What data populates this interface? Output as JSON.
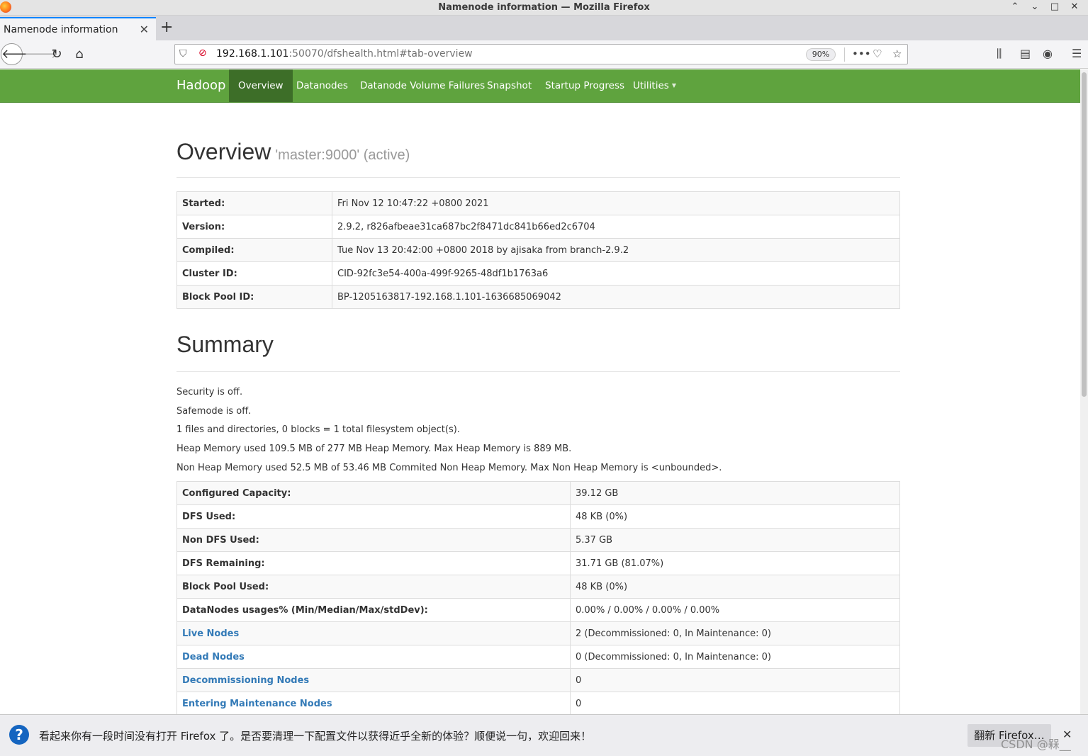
{
  "window": {
    "title": "Namenode information — Mozilla Firefox",
    "controls": [
      "⌃",
      "⌄",
      "□",
      "✕"
    ]
  },
  "tab": {
    "title": "Namenode information",
    "close": "✕",
    "new": "+"
  },
  "toolbar": {
    "url_host": "192.168.1.101",
    "url_rest": ":50070/dfshealth.html#tab-overview",
    "zoom": "90%"
  },
  "hadoop_nav": {
    "brand": "Hadoop",
    "items": [
      "Overview",
      "Datanodes",
      "Datanode Volume Failures",
      "Snapshot",
      "Startup Progress",
      "Utilities"
    ],
    "active": "Overview"
  },
  "overview": {
    "heading": "Overview",
    "subheading": "'master:9000' (active)",
    "rows": [
      {
        "k": "Started:",
        "v": "Fri Nov 12 10:47:22 +0800 2021"
      },
      {
        "k": "Version:",
        "v": "2.9.2, r826afbeae31ca687bc2f8471dc841b66ed2c6704"
      },
      {
        "k": "Compiled:",
        "v": "Tue Nov 13 20:42:00 +0800 2018 by ajisaka from branch-2.9.2"
      },
      {
        "k": "Cluster ID:",
        "v": "CID-92fc3e54-400a-499f-9265-48df1b1763a6"
      },
      {
        "k": "Block Pool ID:",
        "v": "BP-1205163817-192.168.1.101-1636685069042"
      }
    ]
  },
  "summary": {
    "heading": "Summary",
    "lines": [
      "Security is off.",
      "Safemode is off.",
      "1 files and directories, 0 blocks = 1 total filesystem object(s).",
      "Heap Memory used 109.5 MB of 277 MB Heap Memory. Max Heap Memory is 889 MB.",
      "Non Heap Memory used 52.5 MB of 53.46 MB Commited Non Heap Memory. Max Non Heap Memory is <unbounded>."
    ],
    "rows": [
      {
        "k": "Configured Capacity:",
        "v": "39.12 GB"
      },
      {
        "k": "DFS Used:",
        "v": "48 KB (0%)"
      },
      {
        "k": "Non DFS Used:",
        "v": "5.37 GB"
      },
      {
        "k": "DFS Remaining:",
        "v": "31.71 GB (81.07%)"
      },
      {
        "k": "Block Pool Used:",
        "v": "48 KB (0%)"
      },
      {
        "k": "DataNodes usages% (Min/Median/Max/stdDev):",
        "v": "0.00% / 0.00% / 0.00% / 0.00%"
      },
      {
        "k": "Live Nodes",
        "v": "2 (Decommissioned: 0, In Maintenance: 0)",
        "link": true
      },
      {
        "k": "Dead Nodes",
        "v": "0 (Decommissioned: 0, In Maintenance: 0)",
        "link": true
      },
      {
        "k": "Decommissioning Nodes",
        "v": "0",
        "link": true
      },
      {
        "k": "Entering Maintenance Nodes",
        "v": "0",
        "link": true
      }
    ]
  },
  "notification": {
    "message": "看起来你有一段时间没有打开 Firefox 了。是否要清理一下配置文件以获得近乎全新的体验？顺便说一句，欢迎回来！",
    "button": "翻新 Firefox…",
    "close": "✕",
    "watermark": "CSDN @槑__"
  }
}
